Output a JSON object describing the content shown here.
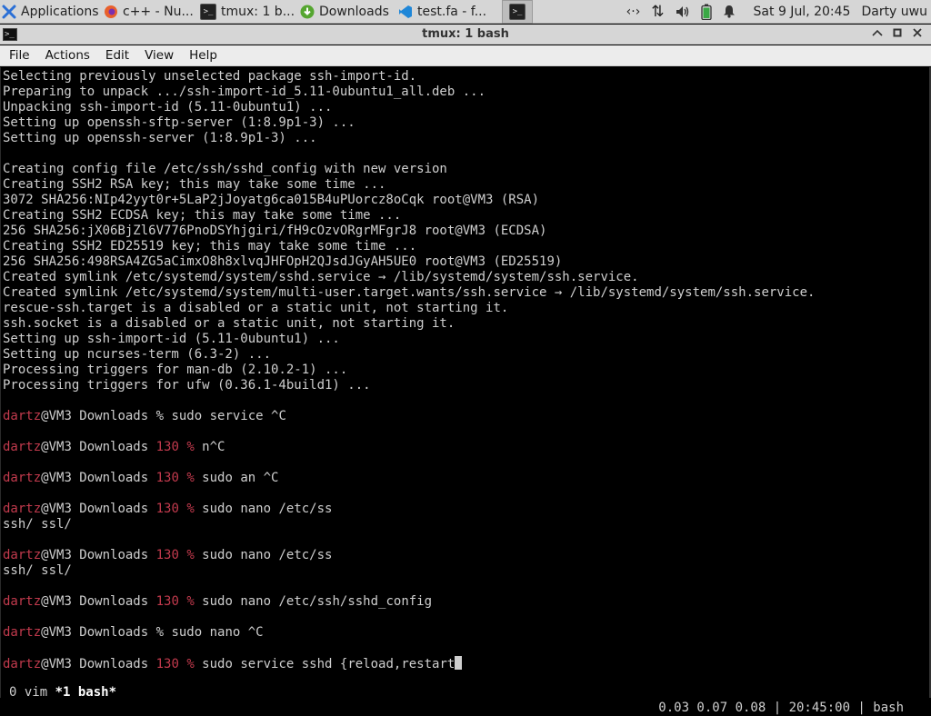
{
  "taskbar": {
    "apps_label": "Applications",
    "apps_suffix": "≡",
    "tasks": [
      {
        "label": "c++ - Nu...",
        "icon": "firefox-icon"
      },
      {
        "label": "tmux: 1 b...",
        "icon": "terminal-icon"
      },
      {
        "label": "Downloads",
        "icon": "download-icon"
      },
      {
        "label": "test.fa - f...",
        "icon": "vscode-icon"
      },
      {
        "label": "",
        "icon": "terminal-icon"
      }
    ],
    "tray": {
      "network": "‹·›",
      "updown": "⇅",
      "volume": "🔊",
      "notification": "🔔",
      "clock": "Sat  9 Jul, 20:45",
      "user": "Darty uwu"
    }
  },
  "window": {
    "title": "tmux: 1 bash",
    "minimize": "^",
    "maximize": "▫",
    "close": "✕"
  },
  "menu": [
    "File",
    "Actions",
    "Edit",
    "View",
    "Help"
  ],
  "terminal": {
    "lines": [
      {
        "text": "Selecting previously unselected package ssh-import-id."
      },
      {
        "text": "Preparing to unpack .../ssh-import-id_5.11-0ubuntu1_all.deb ..."
      },
      {
        "text": "Unpacking ssh-import-id (5.11-0ubuntu1) ..."
      },
      {
        "text": "Setting up openssh-sftp-server (1:8.9p1-3) ..."
      },
      {
        "text": "Setting up openssh-server (1:8.9p1-3) ..."
      },
      {
        "text": ""
      },
      {
        "text": "Creating config file /etc/ssh/sshd_config with new version"
      },
      {
        "text": "Creating SSH2 RSA key; this may take some time ..."
      },
      {
        "text": "3072 SHA256:NIp42yyt0r+5LaP2jJoyatg6ca015B4uPUorcz8oCqk root@VM3 (RSA)"
      },
      {
        "text": "Creating SSH2 ECDSA key; this may take some time ..."
      },
      {
        "text": "256 SHA256:jX06BjZl6V776PnoDSYhjgiri/fH9cOzvORgrMFgrJ8 root@VM3 (ECDSA)"
      },
      {
        "text": "Creating SSH2 ED25519 key; this may take some time ..."
      },
      {
        "text": "256 SHA256:498RSA4ZG5aCimxO8h8xlvqJHFOpH2QJsdJGyAH5UE0 root@VM3 (ED25519)"
      },
      {
        "text": "Created symlink /etc/systemd/system/sshd.service → /lib/systemd/system/ssh.service."
      },
      {
        "text": "Created symlink /etc/systemd/system/multi-user.target.wants/ssh.service → /lib/systemd/system/ssh.service."
      },
      {
        "text": "rescue-ssh.target is a disabled or a static unit, not starting it."
      },
      {
        "text": "ssh.socket is a disabled or a static unit, not starting it."
      },
      {
        "text": "Setting up ssh-import-id (5.11-0ubuntu1) ..."
      },
      {
        "text": "Setting up ncurses-term (6.3-2) ..."
      },
      {
        "text": "Processing triggers for man-db (2.10.2-1) ..."
      },
      {
        "text": "Processing triggers for ufw (0.36.1-4build1) ..."
      },
      {
        "text": ""
      },
      {
        "prompt": true,
        "user": "dartz",
        "host": "@VM3 Downloads ",
        "code": "",
        "sym": "% ",
        "cmd": "sudo service ^C"
      },
      {
        "text": ""
      },
      {
        "prompt": true,
        "user": "dartz",
        "host": "@VM3 Downloads ",
        "code": "130 ",
        "sym": "% ",
        "cmd": "n^C"
      },
      {
        "text": ""
      },
      {
        "prompt": true,
        "user": "dartz",
        "host": "@VM3 Downloads ",
        "code": "130 ",
        "sym": "% ",
        "cmd": "sudo an ^C"
      },
      {
        "text": ""
      },
      {
        "prompt": true,
        "user": "dartz",
        "host": "@VM3 Downloads ",
        "code": "130 ",
        "sym": "% ",
        "cmd": "sudo nano /etc/ss"
      },
      {
        "text": "ssh/ ssl/"
      },
      {
        "text": ""
      },
      {
        "prompt": true,
        "user": "dartz",
        "host": "@VM3 Downloads ",
        "code": "130 ",
        "sym": "% ",
        "cmd": "sudo nano /etc/ss"
      },
      {
        "text": "ssh/ ssl/"
      },
      {
        "text": ""
      },
      {
        "prompt": true,
        "user": "dartz",
        "host": "@VM3 Downloads ",
        "code": "130 ",
        "sym": "% ",
        "cmd": "sudo nano /etc/ssh/sshd_config"
      },
      {
        "text": ""
      },
      {
        "prompt": true,
        "user": "dartz",
        "host": "@VM3 Downloads ",
        "code": "",
        "sym": "% ",
        "cmd": "sudo nano ^C"
      },
      {
        "text": ""
      },
      {
        "prompt": true,
        "user": "dartz",
        "host": "@VM3 Downloads ",
        "code": "130 ",
        "sym": "% ",
        "cmd": "sudo service sshd {reload,restart",
        "cursor": true
      }
    ],
    "status_left_plain": "0 vim ",
    "status_left_active": "*1 bash*",
    "status_right": "0.03 0.07 0.08 | 20:45:00 | bash"
  },
  "colors": {
    "prompt_user": "#c23a4d",
    "terminal_bg": "#000000",
    "terminal_fg": "#cfcfcf"
  }
}
